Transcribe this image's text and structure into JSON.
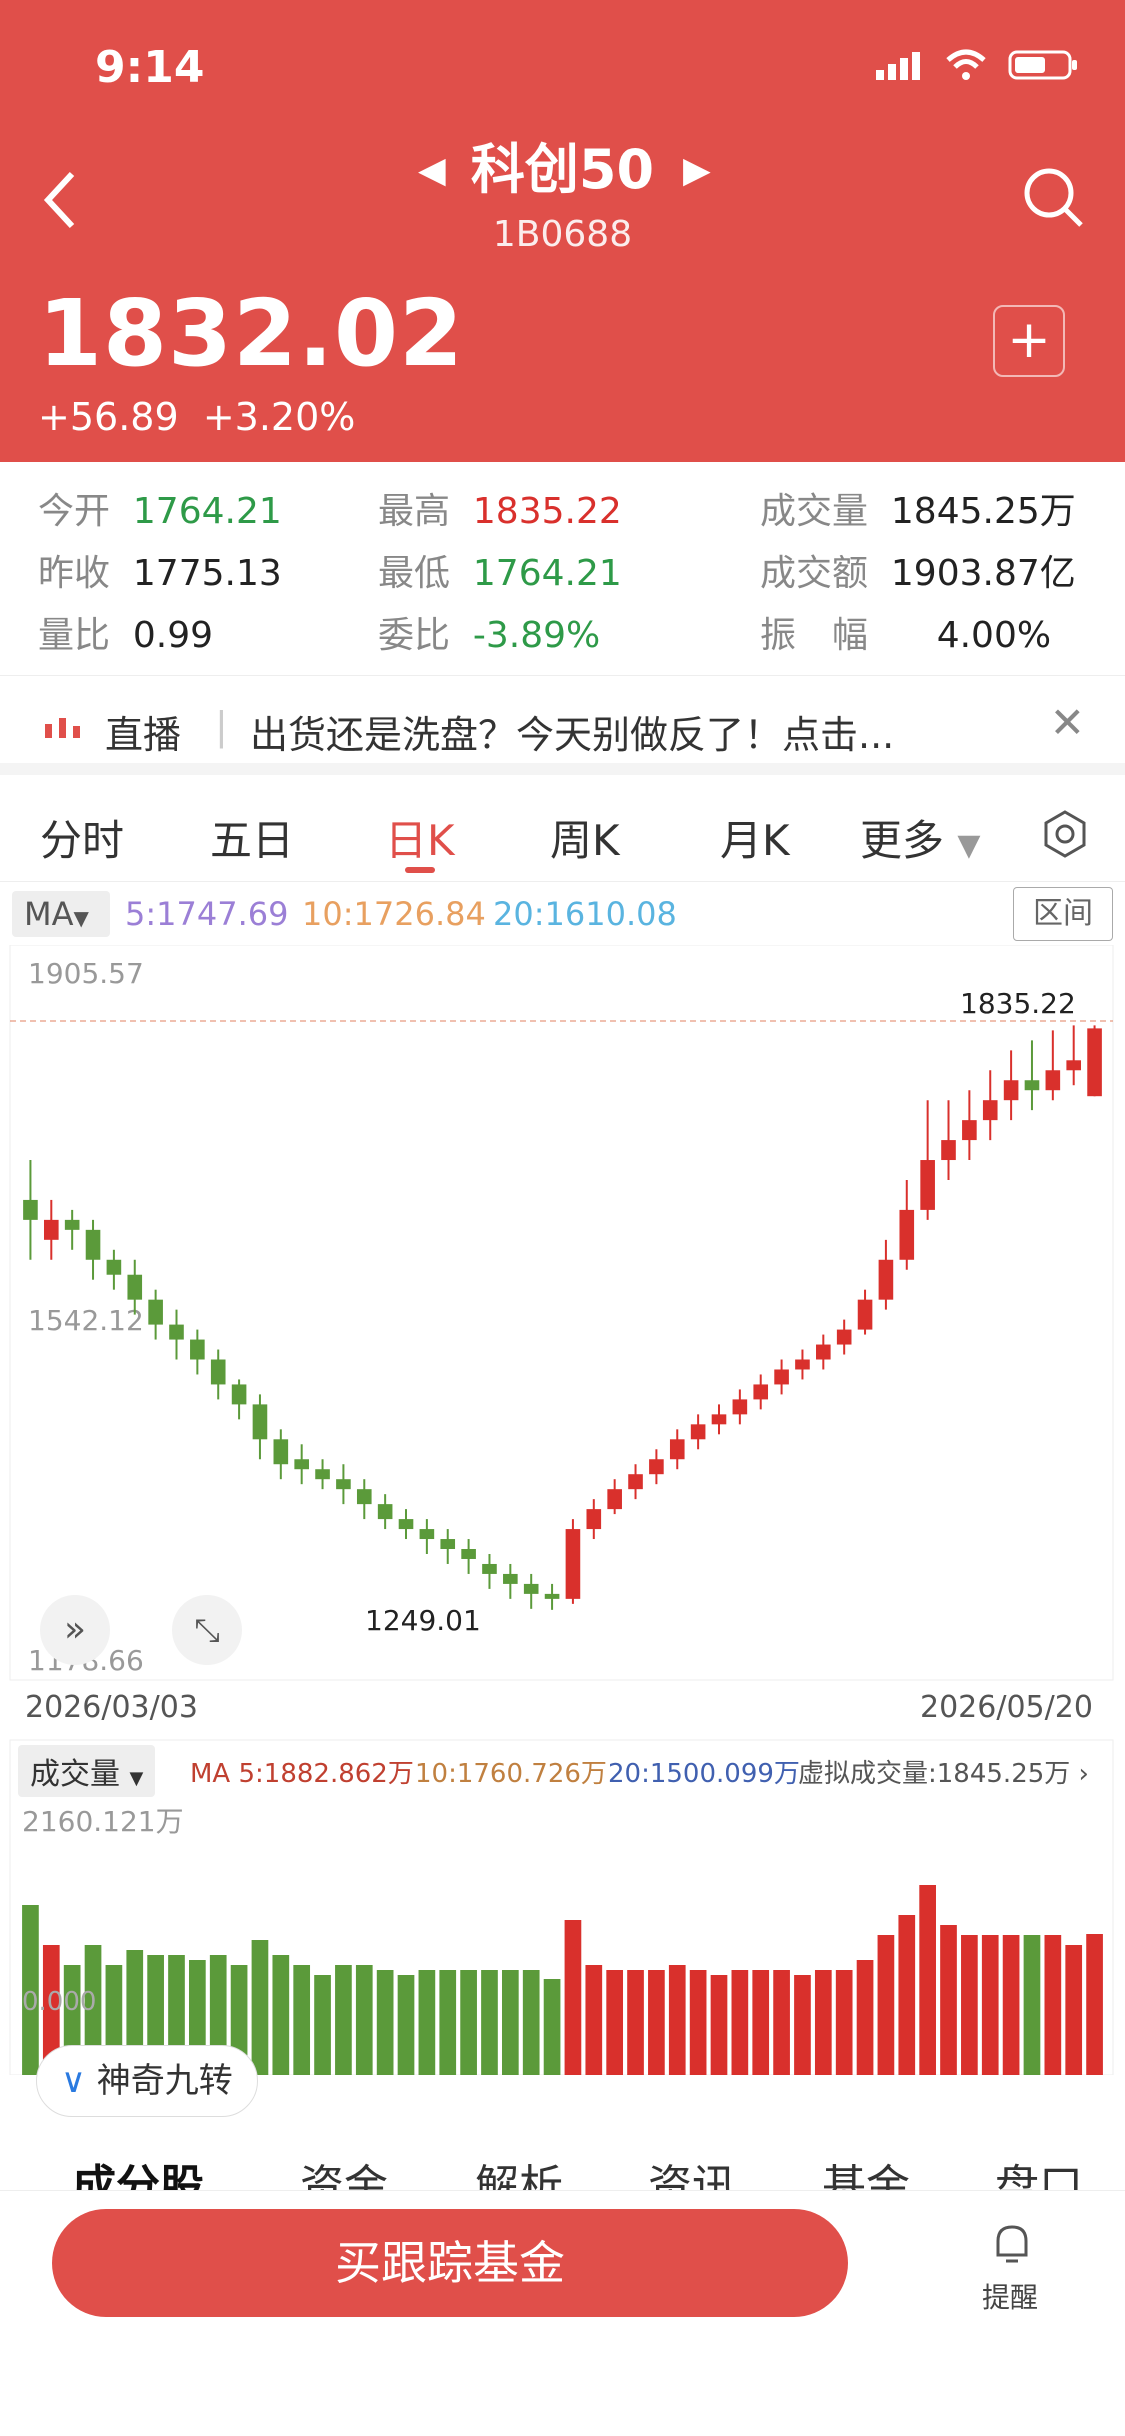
{
  "status": {
    "time": "9:14"
  },
  "header": {
    "title": "科创50",
    "code": "1B0688",
    "price": "1832.02",
    "change": "+56.89",
    "change_pct": "+3.20%"
  },
  "stats": {
    "open_label": "今开",
    "open": "1764.21",
    "high_label": "最高",
    "high": "1835.22",
    "volume_label": "成交量",
    "volume": "1845.25万",
    "prev_label": "昨收",
    "prev": "1775.13",
    "low_label": "最低",
    "low": "1764.21",
    "amount_label": "成交额",
    "amount": "1903.87亿",
    "ratio_label": "量比",
    "ratio": "0.99",
    "commit_label": "委比",
    "commit": "-3.89%",
    "amp_label": "振　幅",
    "amp": "4.00%"
  },
  "banner": {
    "tag": "直播",
    "text": "出货还是洗盘？今天别做反了！点击..."
  },
  "tabs": [
    "分时",
    "五日",
    "日K",
    "周K",
    "月K",
    "更多"
  ],
  "ma": {
    "label": "MA",
    "ma5": "5:1747.69",
    "ma10": "10:1726.84",
    "ma20": "20:1610.08",
    "range_btn": "区间"
  },
  "chart_data": {
    "type": "candlestick",
    "y_top": "1905.57",
    "y_mid": "1542.12",
    "y_bottom": "1178.66",
    "high_label": "1835.22",
    "low_label": "1249.01",
    "date_start": "2026/03/03",
    "date_end": "2026/05/20",
    "candles": [
      [
        1660,
        1640,
        1700,
        1600
      ],
      [
        1620,
        1640,
        1660,
        1600
      ],
      [
        1640,
        1630,
        1650,
        1610
      ],
      [
        1630,
        1600,
        1640,
        1580
      ],
      [
        1600,
        1585,
        1610,
        1570
      ],
      [
        1585,
        1560,
        1600,
        1545
      ],
      [
        1560,
        1535,
        1570,
        1520
      ],
      [
        1535,
        1520,
        1550,
        1500
      ],
      [
        1520,
        1500,
        1530,
        1485
      ],
      [
        1500,
        1475,
        1510,
        1460
      ],
      [
        1475,
        1455,
        1480,
        1440
      ],
      [
        1455,
        1420,
        1465,
        1400
      ],
      [
        1420,
        1395,
        1430,
        1380
      ],
      [
        1400,
        1390,
        1415,
        1375
      ],
      [
        1390,
        1380,
        1400,
        1370
      ],
      [
        1380,
        1370,
        1395,
        1355
      ],
      [
        1370,
        1355,
        1380,
        1340
      ],
      [
        1355,
        1340,
        1365,
        1330
      ],
      [
        1340,
        1330,
        1350,
        1320
      ],
      [
        1330,
        1320,
        1340,
        1305
      ],
      [
        1320,
        1310,
        1330,
        1295
      ],
      [
        1310,
        1300,
        1320,
        1285
      ],
      [
        1295,
        1285,
        1305,
        1270
      ],
      [
        1285,
        1275,
        1295,
        1260
      ],
      [
        1275,
        1265,
        1285,
        1250
      ],
      [
        1265,
        1260,
        1275,
        1249
      ],
      [
        1260,
        1330,
        1340,
        1255
      ],
      [
        1330,
        1350,
        1360,
        1320
      ],
      [
        1350,
        1370,
        1380,
        1345
      ],
      [
        1370,
        1385,
        1395,
        1360
      ],
      [
        1385,
        1400,
        1410,
        1375
      ],
      [
        1400,
        1420,
        1430,
        1390
      ],
      [
        1420,
        1435,
        1445,
        1410
      ],
      [
        1435,
        1445,
        1455,
        1425
      ],
      [
        1445,
        1460,
        1470,
        1435
      ],
      [
        1460,
        1475,
        1485,
        1450
      ],
      [
        1475,
        1490,
        1500,
        1465
      ],
      [
        1490,
        1500,
        1510,
        1480
      ],
      [
        1500,
        1515,
        1525,
        1490
      ],
      [
        1515,
        1530,
        1540,
        1505
      ],
      [
        1530,
        1560,
        1570,
        1525
      ],
      [
        1560,
        1600,
        1620,
        1550
      ],
      [
        1600,
        1650,
        1680,
        1590
      ],
      [
        1650,
        1700,
        1760,
        1640
      ],
      [
        1700,
        1720,
        1760,
        1680
      ],
      [
        1720,
        1740,
        1770,
        1700
      ],
      [
        1740,
        1760,
        1790,
        1720
      ],
      [
        1760,
        1780,
        1810,
        1740
      ],
      [
        1780,
        1770,
        1820,
        1750
      ],
      [
        1770,
        1790,
        1830,
        1760
      ],
      [
        1790,
        1800,
        1835,
        1775
      ],
      [
        1764,
        1832,
        1835,
        1764
      ]
    ]
  },
  "volume": {
    "label": "成交量",
    "ma5": "MA 5:1882.862万",
    "ma10": "10:1760.726万",
    "ma20": "20:1500.099万",
    "virtual": "虚拟成交量:1845.25万",
    "max": "2160.121万",
    "zero": "0.000"
  },
  "feature_btn": "神奇九转",
  "bottom_tabs": [
    "成分股",
    "资金",
    "解析",
    "资讯",
    "基金",
    "盘口"
  ],
  "footer": {
    "buy": "买跟踪基金",
    "remind": "提醒"
  },
  "colors": {
    "brand": "#e04f4a",
    "up": "#d9302c",
    "down": "#5b9a3a"
  }
}
